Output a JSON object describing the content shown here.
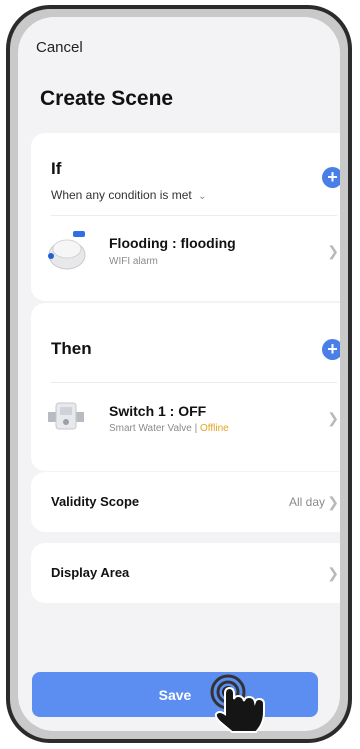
{
  "header": {
    "cancel_label": "Cancel",
    "title": "Create Scene"
  },
  "if_section": {
    "title": "If",
    "condition_mode": "When any condition is met",
    "condition": {
      "name": "Flooding : flooding",
      "device_type": "WIFI alarm",
      "icon": "flood-sensor-icon"
    }
  },
  "then_section": {
    "title": "Then",
    "action": {
      "name": "Switch 1 : OFF",
      "device_type": "Smart Water Valve",
      "separator": " | ",
      "status": "Offline",
      "icon": "water-valve-icon"
    }
  },
  "validity_scope": {
    "label": "Validity Scope",
    "value": "All day"
  },
  "display_area": {
    "label": "Display Area"
  },
  "save_label": "Save",
  "colors": {
    "accent": "#4a7fe8",
    "save_button": "#5b8ef0",
    "offline": "#e5a320"
  }
}
